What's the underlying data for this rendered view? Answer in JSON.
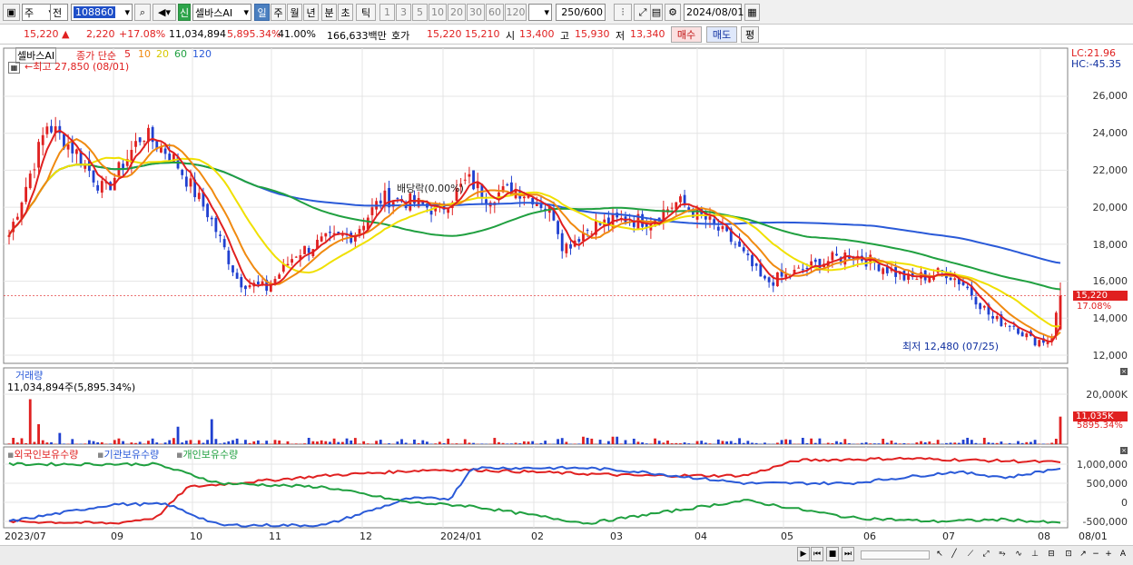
{
  "toolbar": {
    "market": "주",
    "mode": "전",
    "code": "108860",
    "badge": "신",
    "name": "셀바스AI",
    "periods": [
      "일",
      "주",
      "월",
      "년",
      "분",
      "초",
      "틱"
    ],
    "minutes": [
      "1",
      "3",
      "5",
      "10",
      "20",
      "30",
      "60",
      "120"
    ],
    "count": "250",
    "count_total": "/600",
    "date": "2024/08/01"
  },
  "info": {
    "price": "15,220",
    "change": "2,220",
    "change_pct": "+17.08%",
    "volume": "11,034,894",
    "volume_pct": "5,895.34%",
    "ratio": "41.00%",
    "amount": "166,633백만",
    "ask_label": "호가",
    "ask": "15,220",
    "bid": "15,210",
    "open_label": "시",
    "open": "13,400",
    "high_label": "고",
    "high": "15,930",
    "low_label": "저",
    "low": "13,340",
    "buy": "매수",
    "sell": "매도",
    "eval": "평"
  },
  "price_panel": {
    "name": "셀바스AI",
    "ma_label": "종가 단순",
    "ma_periods": [
      "5",
      "10",
      "20",
      "60",
      "120"
    ],
    "high_note": "최고 27,850 (08/01)",
    "low_note": "최저 12,480 (07/25)",
    "dividend_note": "배당락(0.00%)",
    "lc": "LC:21.96",
    "hc": "HC:-45.35",
    "y_ticks": [
      "26,000",
      "24,000",
      "22,000",
      "20,000",
      "18,000",
      "16,000",
      "14,000",
      "12,000"
    ],
    "current": "15,220",
    "current_pct": "17.08%"
  },
  "volume_panel": {
    "title": "거래량",
    "value": "11,034,894주(5,895.34%)",
    "y_tick": "20,000K",
    "current": "11,035K",
    "current_pct": "5895.34%"
  },
  "holding_panel": {
    "legend": [
      "외국인보유수량",
      "기관보유수량",
      "개인보유수량"
    ],
    "y_ticks": [
      "1,000,000",
      "500,000",
      "0",
      "-500,000"
    ]
  },
  "x_axis": [
    "2023/07",
    "09",
    "10",
    "11",
    "12",
    "2024/01",
    "02",
    "03",
    "04",
    "05",
    "06",
    "07",
    "08",
    "08/01"
  ],
  "colors": {
    "up": "#e02020",
    "down": "#2040d0",
    "ma5": "#e02020",
    "ma10": "#f08a10",
    "ma20": "#f0e000",
    "ma60": "#20a040",
    "ma120": "#2a5ad8",
    "frame": "#808080"
  },
  "chart_data": {
    "type": "candlestick",
    "period": "daily",
    "x_range": [
      "2023/07",
      "2024/08/01"
    ],
    "ylim": [
      12000,
      28000
    ],
    "close_path": [
      [
        0,
        18500
      ],
      [
        4,
        24500
      ],
      [
        7,
        23000
      ],
      [
        10,
        20800
      ],
      [
        14,
        24000
      ],
      [
        17,
        22800
      ],
      [
        21,
        19500
      ],
      [
        24,
        16000
      ],
      [
        27,
        15600
      ],
      [
        30,
        17500
      ],
      [
        33,
        18200
      ],
      [
        36,
        18500
      ],
      [
        39,
        20500
      ],
      [
        42,
        20300
      ],
      [
        45,
        19800
      ],
      [
        48,
        21500
      ],
      [
        50,
        20600
      ],
      [
        53,
        21000
      ],
      [
        55,
        20500
      ],
      [
        57,
        19600
      ],
      [
        58,
        17800
      ],
      [
        61,
        19000
      ],
      [
        64,
        19300
      ],
      [
        67,
        19300
      ],
      [
        70,
        20300
      ],
      [
        73,
        19300
      ],
      [
        76,
        18000
      ],
      [
        79,
        15900
      ],
      [
        82,
        16400
      ],
      [
        85,
        17000
      ],
      [
        88,
        17500
      ],
      [
        91,
        16900
      ],
      [
        94,
        16100
      ],
      [
        96,
        16300
      ],
      [
        98,
        16500
      ],
      [
        100,
        15800
      ],
      [
        103,
        13900
      ],
      [
        105,
        13700
      ],
      [
        107,
        12800
      ],
      [
        109,
        12800
      ],
      [
        110,
        15220
      ]
    ],
    "last": {
      "open": 13400,
      "high": 15930,
      "low": 13340,
      "close": 15220
    },
    "moving_averages": [
      "5",
      "10",
      "20",
      "60",
      "120"
    ]
  }
}
